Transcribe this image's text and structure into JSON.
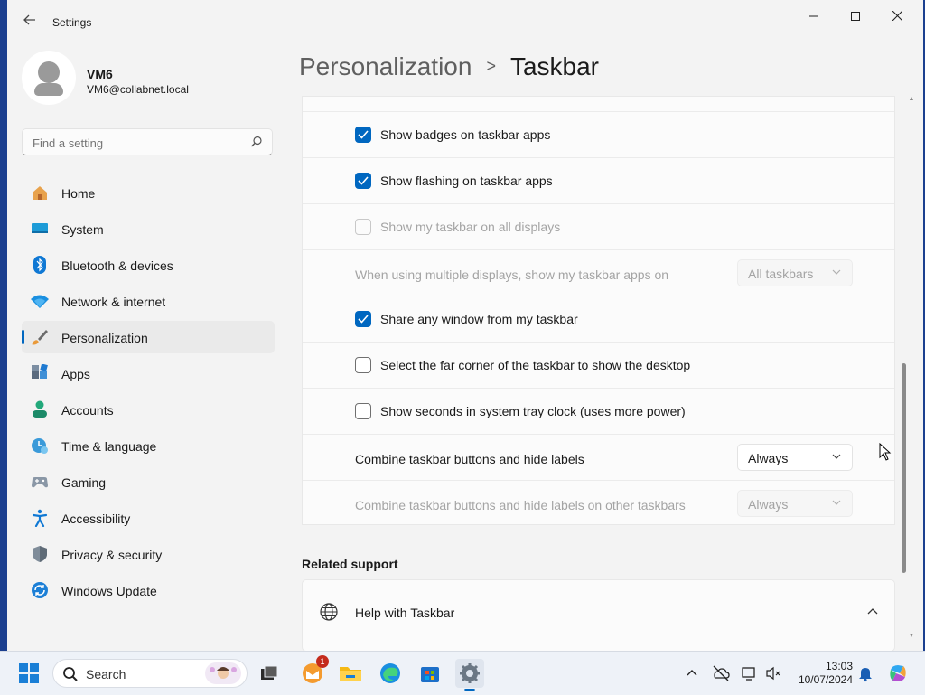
{
  "window": {
    "title": "Settings",
    "controls": [
      "minimize",
      "maximize",
      "close"
    ]
  },
  "profile": {
    "name": "VM6",
    "email": "VM6@collabnet.local"
  },
  "search": {
    "placeholder": "Find a setting"
  },
  "nav": {
    "items": [
      {
        "label": "Home",
        "icon": "home-icon"
      },
      {
        "label": "System",
        "icon": "system-icon"
      },
      {
        "label": "Bluetooth & devices",
        "icon": "bluetooth-icon"
      },
      {
        "label": "Network & internet",
        "icon": "network-icon"
      },
      {
        "label": "Personalization",
        "icon": "personalization-icon",
        "selected": true
      },
      {
        "label": "Apps",
        "icon": "apps-icon"
      },
      {
        "label": "Accounts",
        "icon": "accounts-icon"
      },
      {
        "label": "Time & language",
        "icon": "time-language-icon"
      },
      {
        "label": "Gaming",
        "icon": "gaming-icon"
      },
      {
        "label": "Accessibility",
        "icon": "accessibility-icon"
      },
      {
        "label": "Privacy & security",
        "icon": "privacy-shield-icon"
      },
      {
        "label": "Windows Update",
        "icon": "windows-update-icon"
      }
    ]
  },
  "breadcrumb": {
    "parent": "Personalization",
    "separator": ">",
    "current": "Taskbar"
  },
  "settings": {
    "rows": [
      {
        "label": "Show badges on taskbar apps",
        "type": "checkbox",
        "checked": true,
        "enabled": true
      },
      {
        "label": "Show flashing on taskbar apps",
        "type": "checkbox",
        "checked": true,
        "enabled": true
      },
      {
        "label": "Show my taskbar on all displays",
        "type": "checkbox",
        "checked": false,
        "enabled": false
      },
      {
        "label": "When using multiple displays, show my taskbar apps on",
        "type": "dropdown",
        "value": "All taskbars",
        "enabled": false
      },
      {
        "label": "Share any window from my taskbar",
        "type": "checkbox",
        "checked": true,
        "enabled": true
      },
      {
        "label": "Select the far corner of the taskbar to show the desktop",
        "type": "checkbox",
        "checked": false,
        "enabled": true
      },
      {
        "label": "Show seconds in system tray clock (uses more power)",
        "type": "checkbox",
        "checked": false,
        "enabled": true
      },
      {
        "label": "Combine taskbar buttons and hide labels",
        "type": "dropdown",
        "value": "Always",
        "enabled": true
      },
      {
        "label": "Combine taskbar buttons and hide labels on other taskbars",
        "type": "dropdown",
        "value": "Always",
        "enabled": false
      }
    ]
  },
  "related": {
    "title": "Related support",
    "help_label": "Help with Taskbar"
  },
  "taskbar": {
    "search_label": "Search",
    "mail_badge": "1",
    "apps": [
      "start-icon",
      "task-view-icon",
      "mail-icon",
      "file-explorer-icon",
      "edge-icon",
      "store-icon",
      "settings-gear-icon"
    ],
    "time": "13:03",
    "date": "10/07/2024"
  },
  "colors": {
    "accent": "#0067c0",
    "window_bg": "#f3f3f3",
    "card_bg": "#fbfbfb",
    "disabled_text": "#a4a4a4"
  }
}
